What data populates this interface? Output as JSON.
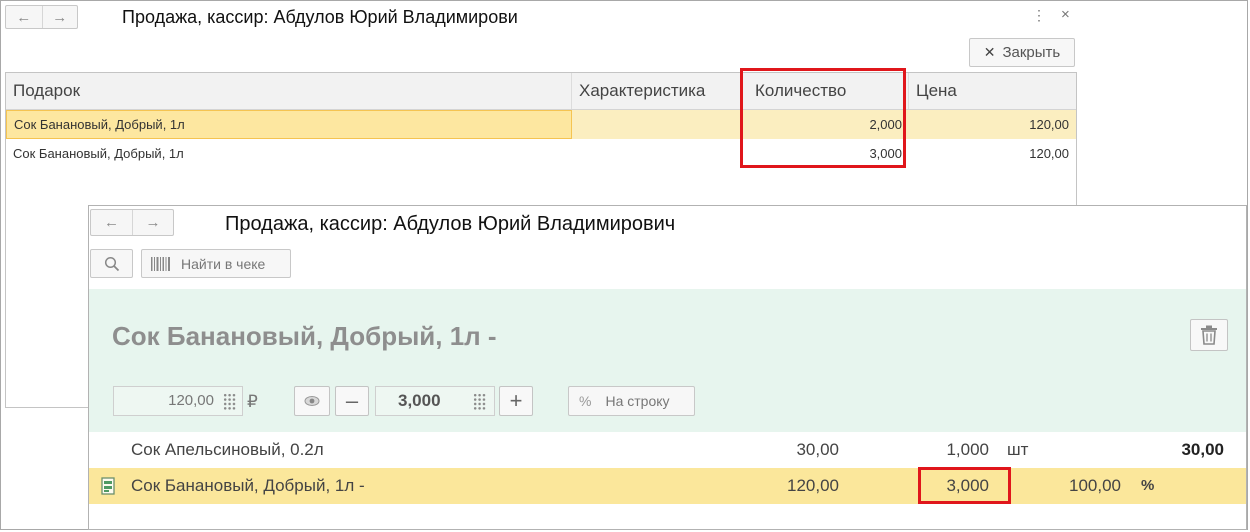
{
  "back_window": {
    "title": "Продажа, кассир: Абдулов Юрий Владимирови",
    "close_button": "Закрыть",
    "columns": [
      "Подарок",
      "Характеристика",
      "Количество",
      "Цена"
    ],
    "rows": [
      {
        "gift": "Сок Банановый, Добрый, 1л",
        "characteristic": "",
        "quantity": "2,000",
        "price": "120,00"
      },
      {
        "gift": "Сок Банановый, Добрый, 1л",
        "characteristic": "",
        "quantity": "3,000",
        "price": "120,00"
      }
    ]
  },
  "front_window": {
    "title": "Продажа, кассир: Абдулов Юрий Владимирович",
    "search_button": "Найти в чеке",
    "product_title": "Сок Банановый, Добрый, 1л -",
    "price_field": "120,00",
    "currency": "₽",
    "quantity_field": "3,000",
    "per_line_button": "На строку",
    "percent_sign": "%",
    "items": [
      {
        "name": "Сок Апельсиновый, 0.2л",
        "price": "30,00",
        "quantity": "1,000",
        "unit": "шт",
        "discount": "",
        "discount_unit": "",
        "sum": "30,00"
      },
      {
        "name": "Сок Банановый, Добрый, 1л -",
        "price": "120,00",
        "quantity": "3,000",
        "unit": "",
        "discount": "100,00",
        "discount_unit": "%",
        "sum": ""
      }
    ]
  },
  "colors": {
    "highlight_red": "#e0161b",
    "selected_row": "#fbe79b",
    "panel_green": "#e7f5ee"
  }
}
